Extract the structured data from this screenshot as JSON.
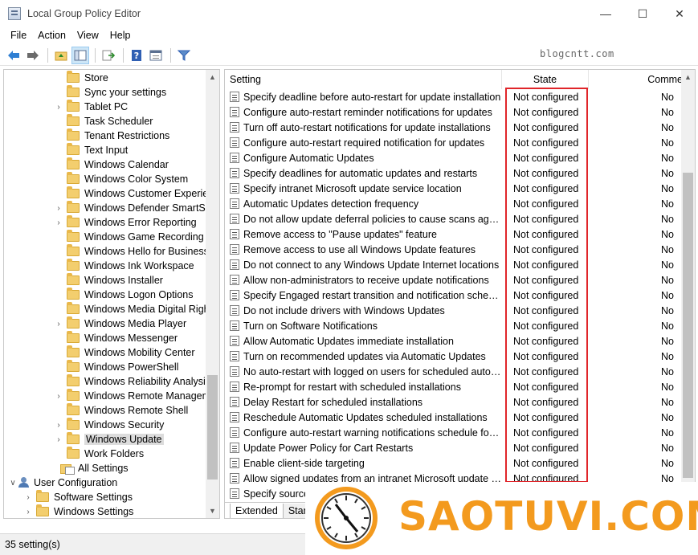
{
  "window": {
    "title": "Local Group Policy Editor",
    "minimize": "—",
    "maximize": "☐",
    "close": "✕"
  },
  "menu": [
    "File",
    "Action",
    "View",
    "Help"
  ],
  "watermark": "blogcntt.com",
  "tree": {
    "items": [
      {
        "label": "Store",
        "expandable": false,
        "indent": 1
      },
      {
        "label": "Sync your settings",
        "expandable": false,
        "indent": 1
      },
      {
        "label": "Tablet PC",
        "expandable": true,
        "indent": 1
      },
      {
        "label": "Task Scheduler",
        "expandable": false,
        "indent": 1
      },
      {
        "label": "Tenant Restrictions",
        "expandable": false,
        "indent": 1
      },
      {
        "label": "Text Input",
        "expandable": false,
        "indent": 1
      },
      {
        "label": "Windows Calendar",
        "expandable": false,
        "indent": 1
      },
      {
        "label": "Windows Color System",
        "expandable": false,
        "indent": 1
      },
      {
        "label": "Windows Customer Experien",
        "expandable": false,
        "indent": 1
      },
      {
        "label": "Windows Defender SmartScr",
        "expandable": true,
        "indent": 1
      },
      {
        "label": "Windows Error Reporting",
        "expandable": true,
        "indent": 1
      },
      {
        "label": "Windows Game Recording ar",
        "expandable": false,
        "indent": 1
      },
      {
        "label": "Windows Hello for Business",
        "expandable": false,
        "indent": 1
      },
      {
        "label": "Windows Ink Workspace",
        "expandable": false,
        "indent": 1
      },
      {
        "label": "Windows Installer",
        "expandable": false,
        "indent": 1
      },
      {
        "label": "Windows Logon Options",
        "expandable": false,
        "indent": 1
      },
      {
        "label": "Windows Media Digital Right",
        "expandable": false,
        "indent": 1
      },
      {
        "label": "Windows Media Player",
        "expandable": true,
        "indent": 1
      },
      {
        "label": "Windows Messenger",
        "expandable": false,
        "indent": 1
      },
      {
        "label": "Windows Mobility Center",
        "expandable": false,
        "indent": 1
      },
      {
        "label": "Windows PowerShell",
        "expandable": false,
        "indent": 1
      },
      {
        "label": "Windows Reliability Analysis",
        "expandable": false,
        "indent": 1
      },
      {
        "label": "Windows Remote Managem",
        "expandable": true,
        "indent": 1
      },
      {
        "label": "Windows Remote Shell",
        "expandable": false,
        "indent": 1
      },
      {
        "label": "Windows Security",
        "expandable": true,
        "indent": 1
      },
      {
        "label": "Windows Update",
        "expandable": true,
        "indent": 1,
        "selected": true
      },
      {
        "label": "Work Folders",
        "expandable": false,
        "indent": 1
      },
      {
        "label": "All Settings",
        "expandable": false,
        "indent": 0,
        "icon": "all-settings"
      },
      {
        "label": "User Configuration",
        "expandable": true,
        "expanded": true,
        "indent": -1,
        "icon": "user"
      },
      {
        "label": "Software Settings",
        "expandable": true,
        "indent": -0.5
      },
      {
        "label": "Windows Settings",
        "expandable": true,
        "indent": -0.5
      }
    ]
  },
  "list": {
    "headers": {
      "setting": "Setting",
      "state": "State",
      "comment": "Comme"
    },
    "rows": [
      {
        "setting": "Specify deadline before auto-restart for update installation",
        "state": "Not configured",
        "comment": "No"
      },
      {
        "setting": "Configure auto-restart reminder notifications for updates",
        "state": "Not configured",
        "comment": "No"
      },
      {
        "setting": "Turn off auto-restart notifications for update installations",
        "state": "Not configured",
        "comment": "No"
      },
      {
        "setting": "Configure auto-restart required notification for updates",
        "state": "Not configured",
        "comment": "No"
      },
      {
        "setting": "Configure Automatic Updates",
        "state": "Not configured",
        "comment": "No"
      },
      {
        "setting": "Specify deadlines for automatic updates and restarts",
        "state": "Not configured",
        "comment": "No"
      },
      {
        "setting": "Specify intranet Microsoft update service location",
        "state": "Not configured",
        "comment": "No"
      },
      {
        "setting": "Automatic Updates detection frequency",
        "state": "Not configured",
        "comment": "No"
      },
      {
        "setting": "Do not allow update deferral policies to cause scans against ...",
        "state": "Not configured",
        "comment": "No"
      },
      {
        "setting": "Remove access to \"Pause updates\" feature",
        "state": "Not configured",
        "comment": "No"
      },
      {
        "setting": "Remove access to use all Windows Update features",
        "state": "Not configured",
        "comment": "No"
      },
      {
        "setting": "Do not connect to any Windows Update Internet locations",
        "state": "Not configured",
        "comment": "No"
      },
      {
        "setting": "Allow non-administrators to receive update notifications",
        "state": "Not configured",
        "comment": "No"
      },
      {
        "setting": "Specify Engaged restart transition and notification schedule ...",
        "state": "Not configured",
        "comment": "No"
      },
      {
        "setting": "Do not include drivers with Windows Updates",
        "state": "Not configured",
        "comment": "No"
      },
      {
        "setting": "Turn on Software Notifications",
        "state": "Not configured",
        "comment": "No"
      },
      {
        "setting": "Allow Automatic Updates immediate installation",
        "state": "Not configured",
        "comment": "No"
      },
      {
        "setting": "Turn on recommended updates via Automatic Updates",
        "state": "Not configured",
        "comment": "No"
      },
      {
        "setting": "No auto-restart with logged on users for scheduled automat...",
        "state": "Not configured",
        "comment": "No"
      },
      {
        "setting": "Re-prompt for restart with scheduled installations",
        "state": "Not configured",
        "comment": "No"
      },
      {
        "setting": "Delay Restart for scheduled installations",
        "state": "Not configured",
        "comment": "No"
      },
      {
        "setting": "Reschedule Automatic Updates scheduled installations",
        "state": "Not configured",
        "comment": "No"
      },
      {
        "setting": "Configure auto-restart warning notifications schedule for u...",
        "state": "Not configured",
        "comment": "No"
      },
      {
        "setting": "Update Power Policy for Cart Restarts",
        "state": "Not configured",
        "comment": "No"
      },
      {
        "setting": "Enable client-side targeting",
        "state": "Not configured",
        "comment": "No"
      },
      {
        "setting": "Allow signed updates from an intranet Microsoft update ser...",
        "state": "Not configured",
        "comment": "No"
      },
      {
        "setting": "Specify source",
        "state": "",
        "comment": ""
      }
    ],
    "tabs": [
      "Extended",
      "Stand"
    ],
    "highlight_color": "#e0252a"
  },
  "status": {
    "text": "35 setting(s)"
  },
  "logo": {
    "text": "SAOTUVI.COM",
    "color": "#f39a1e"
  }
}
